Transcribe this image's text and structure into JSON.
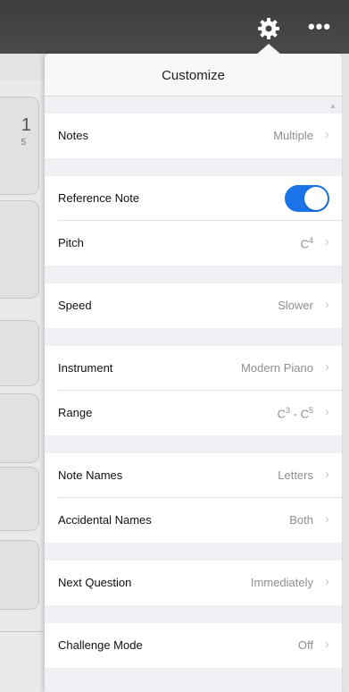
{
  "popover": {
    "title": "Customize"
  },
  "left_panel": {
    "card_number": "1",
    "card_sub": "5"
  },
  "toolbar": {
    "more_label": "•••"
  },
  "settings": {
    "notes": {
      "label": "Notes",
      "value": "Multiple"
    },
    "reference_note": {
      "label": "Reference Note",
      "enabled": true
    },
    "pitch": {
      "label": "Pitch",
      "value_base": "C",
      "value_octave": "4"
    },
    "speed": {
      "label": "Speed",
      "value": "Slower"
    },
    "instrument": {
      "label": "Instrument",
      "value": "Modern Piano"
    },
    "range": {
      "label": "Range",
      "low_base": "C",
      "low_octave": "3",
      "separator": " - ",
      "high_base": "C",
      "high_octave": "5"
    },
    "note_names": {
      "label": "Note Names",
      "value": "Letters"
    },
    "accidental_names": {
      "label": "Accidental Names",
      "value": "Both"
    },
    "next_question": {
      "label": "Next Question",
      "value": "Immediately"
    },
    "challenge_mode": {
      "label": "Challenge Mode",
      "value": "Off"
    }
  },
  "colors": {
    "toggle_on": "#1a73e8",
    "top_bar": "#444444",
    "chevron": "#c7c7cc"
  },
  "icons": {
    "gear": "gear-icon",
    "more": "more-icon",
    "chevron": "chevron-right-icon"
  }
}
